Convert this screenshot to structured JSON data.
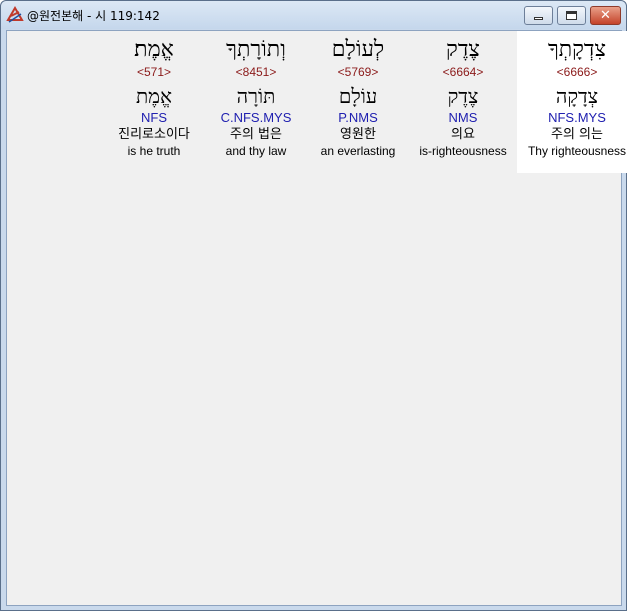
{
  "window": {
    "title": "@원전본해 - 시 119:142",
    "icon": "app-logo-icon"
  },
  "words": [
    {
      "hebrew": "צִדְקָתְךָ",
      "strong": "<6666>",
      "lemma": "צְדָקָה",
      "morph": "NFS.MYS",
      "korean": "주의 의는",
      "english": "Thy righteousness",
      "selected": true
    },
    {
      "hebrew": "צֶדֶק",
      "strong": "<6664>",
      "lemma": "צֶדֶק",
      "morph": "NMS",
      "korean": "의요",
      "english": "is-righteousness",
      "selected": false
    },
    {
      "hebrew": "לְעוֹלָם",
      "strong": "<5769>",
      "lemma": "עוֹלָם",
      "morph": "P.NMS",
      "korean": "영원한",
      "english": "an everlasting",
      "selected": false
    },
    {
      "hebrew": "וְתוֹרָתְךָ",
      "strong": "<8451>",
      "lemma": "תּוֹרָה",
      "morph": "C.NFS.MYS",
      "korean": "주의 법은",
      "english": "and thy law",
      "selected": false
    },
    {
      "hebrew": "אֱמֶת׃",
      "strong": "<571>",
      "lemma": "אֱמֶת",
      "morph": "NFS",
      "korean": "진리로소이다",
      "english": "is he truth",
      "selected": false
    }
  ],
  "colors": {
    "strong": "#8b1a1a",
    "morph": "#2020b0",
    "selected_bg": "#ffffff",
    "content_bg": "#f0f0f0"
  }
}
